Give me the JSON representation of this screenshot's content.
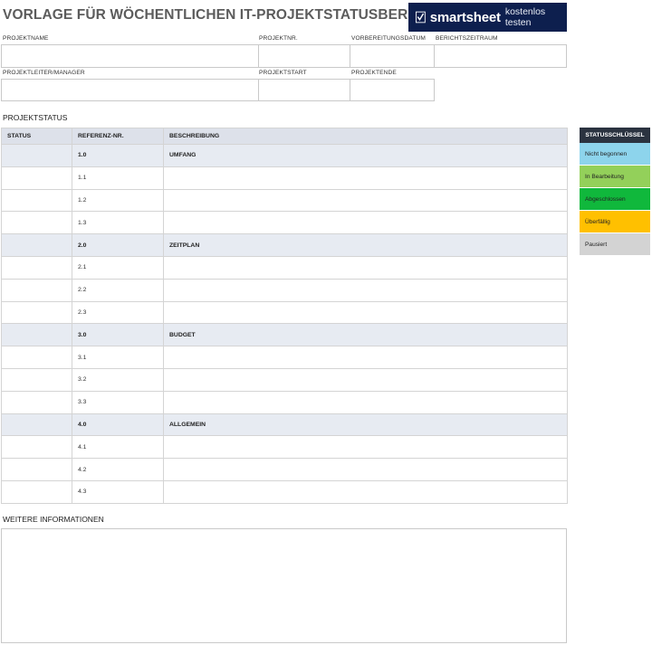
{
  "title": "VORLAGE FÜR WÖCHENTLICHEN IT-PROJEKTSTATUSBERICHT",
  "brand": {
    "name": "smartsheet",
    "cta": "kostenlos testen"
  },
  "fields": {
    "row1": [
      "PROJEKTNAME",
      "PROJEKTNR.",
      "VORBEREITUNGSDATUM",
      "BERICHTSZEITRAUM"
    ],
    "row2": [
      "PROJEKTLEITER/MANAGER",
      "PROJEKTSTART",
      "PROJEKTENDE"
    ]
  },
  "status_section": {
    "title": "PROJEKTSTATUS",
    "columns": [
      "STATUS",
      "REFERENZ-NR.",
      "BESCHREIBUNG"
    ],
    "rows": [
      {
        "ref": "1.0",
        "desc": "UMFANG",
        "section": true
      },
      {
        "ref": "1.1",
        "desc": "",
        "section": false
      },
      {
        "ref": "1.2",
        "desc": "",
        "section": false
      },
      {
        "ref": "1.3",
        "desc": "",
        "section": false
      },
      {
        "ref": "2.0",
        "desc": "ZEITPLAN",
        "section": true
      },
      {
        "ref": "2.1",
        "desc": "",
        "section": false
      },
      {
        "ref": "2.2",
        "desc": "",
        "section": false
      },
      {
        "ref": "2.3",
        "desc": "",
        "section": false
      },
      {
        "ref": "3.0",
        "desc": "BUDGET",
        "section": true
      },
      {
        "ref": "3.1",
        "desc": "",
        "section": false
      },
      {
        "ref": "3.2",
        "desc": "",
        "section": false
      },
      {
        "ref": "3.3",
        "desc": "",
        "section": false
      },
      {
        "ref": "4.0",
        "desc": "ALLGEMEIN",
        "section": true
      },
      {
        "ref": "4.1",
        "desc": "",
        "section": false
      },
      {
        "ref": "4.2",
        "desc": "",
        "section": false
      },
      {
        "ref": "4.3",
        "desc": "",
        "section": false
      }
    ]
  },
  "status_key": {
    "title": "STATUSSCHLÜSSEL",
    "items": [
      {
        "label": "Nicht begonnen",
        "color": "#8dd4ec"
      },
      {
        "label": "In Bearbeitung",
        "color": "#93d05a"
      },
      {
        "label": "Abgeschlossen",
        "color": "#10b83c"
      },
      {
        "label": "Überfällig",
        "color": "#ffc000"
      },
      {
        "label": "Pausiert",
        "color": "#d3d3d3"
      }
    ]
  },
  "info_section": {
    "title": "WEITERE INFORMATIONEN"
  }
}
